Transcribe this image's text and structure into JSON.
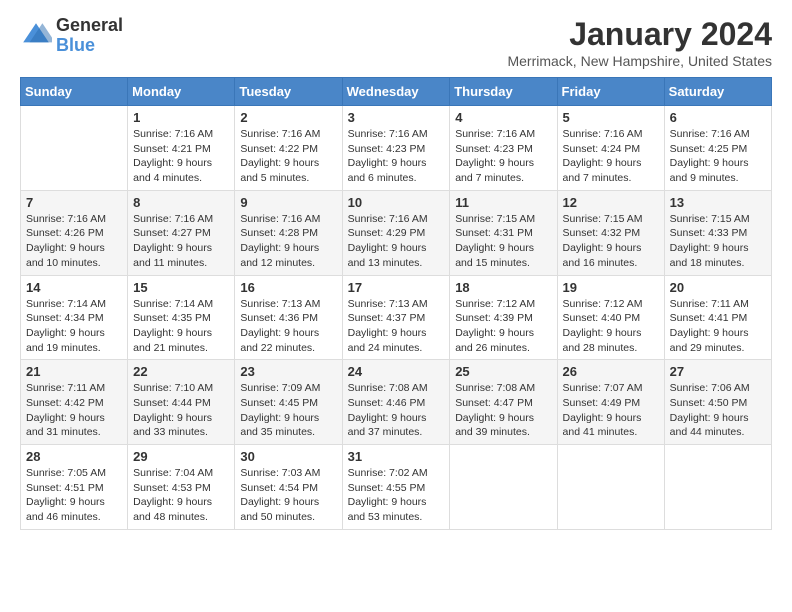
{
  "logo": {
    "line1": "General",
    "line2": "Blue"
  },
  "title": "January 2024",
  "location": "Merrimack, New Hampshire, United States",
  "header": {
    "days": [
      "Sunday",
      "Monday",
      "Tuesday",
      "Wednesday",
      "Thursday",
      "Friday",
      "Saturday"
    ]
  },
  "weeks": [
    [
      {
        "day": "",
        "sunrise": "",
        "sunset": "",
        "daylight": ""
      },
      {
        "day": "1",
        "sunrise": "Sunrise: 7:16 AM",
        "sunset": "Sunset: 4:21 PM",
        "daylight": "Daylight: 9 hours and 4 minutes."
      },
      {
        "day": "2",
        "sunrise": "Sunrise: 7:16 AM",
        "sunset": "Sunset: 4:22 PM",
        "daylight": "Daylight: 9 hours and 5 minutes."
      },
      {
        "day": "3",
        "sunrise": "Sunrise: 7:16 AM",
        "sunset": "Sunset: 4:23 PM",
        "daylight": "Daylight: 9 hours and 6 minutes."
      },
      {
        "day": "4",
        "sunrise": "Sunrise: 7:16 AM",
        "sunset": "Sunset: 4:23 PM",
        "daylight": "Daylight: 9 hours and 7 minutes."
      },
      {
        "day": "5",
        "sunrise": "Sunrise: 7:16 AM",
        "sunset": "Sunset: 4:24 PM",
        "daylight": "Daylight: 9 hours and 7 minutes."
      },
      {
        "day": "6",
        "sunrise": "Sunrise: 7:16 AM",
        "sunset": "Sunset: 4:25 PM",
        "daylight": "Daylight: 9 hours and 9 minutes."
      }
    ],
    [
      {
        "day": "7",
        "sunrise": "Sunrise: 7:16 AM",
        "sunset": "Sunset: 4:26 PM",
        "daylight": "Daylight: 9 hours and 10 minutes."
      },
      {
        "day": "8",
        "sunrise": "Sunrise: 7:16 AM",
        "sunset": "Sunset: 4:27 PM",
        "daylight": "Daylight: 9 hours and 11 minutes."
      },
      {
        "day": "9",
        "sunrise": "Sunrise: 7:16 AM",
        "sunset": "Sunset: 4:28 PM",
        "daylight": "Daylight: 9 hours and 12 minutes."
      },
      {
        "day": "10",
        "sunrise": "Sunrise: 7:16 AM",
        "sunset": "Sunset: 4:29 PM",
        "daylight": "Daylight: 9 hours and 13 minutes."
      },
      {
        "day": "11",
        "sunrise": "Sunrise: 7:15 AM",
        "sunset": "Sunset: 4:31 PM",
        "daylight": "Daylight: 9 hours and 15 minutes."
      },
      {
        "day": "12",
        "sunrise": "Sunrise: 7:15 AM",
        "sunset": "Sunset: 4:32 PM",
        "daylight": "Daylight: 9 hours and 16 minutes."
      },
      {
        "day": "13",
        "sunrise": "Sunrise: 7:15 AM",
        "sunset": "Sunset: 4:33 PM",
        "daylight": "Daylight: 9 hours and 18 minutes."
      }
    ],
    [
      {
        "day": "14",
        "sunrise": "Sunrise: 7:14 AM",
        "sunset": "Sunset: 4:34 PM",
        "daylight": "Daylight: 9 hours and 19 minutes."
      },
      {
        "day": "15",
        "sunrise": "Sunrise: 7:14 AM",
        "sunset": "Sunset: 4:35 PM",
        "daylight": "Daylight: 9 hours and 21 minutes."
      },
      {
        "day": "16",
        "sunrise": "Sunrise: 7:13 AM",
        "sunset": "Sunset: 4:36 PM",
        "daylight": "Daylight: 9 hours and 22 minutes."
      },
      {
        "day": "17",
        "sunrise": "Sunrise: 7:13 AM",
        "sunset": "Sunset: 4:37 PM",
        "daylight": "Daylight: 9 hours and 24 minutes."
      },
      {
        "day": "18",
        "sunrise": "Sunrise: 7:12 AM",
        "sunset": "Sunset: 4:39 PM",
        "daylight": "Daylight: 9 hours and 26 minutes."
      },
      {
        "day": "19",
        "sunrise": "Sunrise: 7:12 AM",
        "sunset": "Sunset: 4:40 PM",
        "daylight": "Daylight: 9 hours and 28 minutes."
      },
      {
        "day": "20",
        "sunrise": "Sunrise: 7:11 AM",
        "sunset": "Sunset: 4:41 PM",
        "daylight": "Daylight: 9 hours and 29 minutes."
      }
    ],
    [
      {
        "day": "21",
        "sunrise": "Sunrise: 7:11 AM",
        "sunset": "Sunset: 4:42 PM",
        "daylight": "Daylight: 9 hours and 31 minutes."
      },
      {
        "day": "22",
        "sunrise": "Sunrise: 7:10 AM",
        "sunset": "Sunset: 4:44 PM",
        "daylight": "Daylight: 9 hours and 33 minutes."
      },
      {
        "day": "23",
        "sunrise": "Sunrise: 7:09 AM",
        "sunset": "Sunset: 4:45 PM",
        "daylight": "Daylight: 9 hours and 35 minutes."
      },
      {
        "day": "24",
        "sunrise": "Sunrise: 7:08 AM",
        "sunset": "Sunset: 4:46 PM",
        "daylight": "Daylight: 9 hours and 37 minutes."
      },
      {
        "day": "25",
        "sunrise": "Sunrise: 7:08 AM",
        "sunset": "Sunset: 4:47 PM",
        "daylight": "Daylight: 9 hours and 39 minutes."
      },
      {
        "day": "26",
        "sunrise": "Sunrise: 7:07 AM",
        "sunset": "Sunset: 4:49 PM",
        "daylight": "Daylight: 9 hours and 41 minutes."
      },
      {
        "day": "27",
        "sunrise": "Sunrise: 7:06 AM",
        "sunset": "Sunset: 4:50 PM",
        "daylight": "Daylight: 9 hours and 44 minutes."
      }
    ],
    [
      {
        "day": "28",
        "sunrise": "Sunrise: 7:05 AM",
        "sunset": "Sunset: 4:51 PM",
        "daylight": "Daylight: 9 hours and 46 minutes."
      },
      {
        "day": "29",
        "sunrise": "Sunrise: 7:04 AM",
        "sunset": "Sunset: 4:53 PM",
        "daylight": "Daylight: 9 hours and 48 minutes."
      },
      {
        "day": "30",
        "sunrise": "Sunrise: 7:03 AM",
        "sunset": "Sunset: 4:54 PM",
        "daylight": "Daylight: 9 hours and 50 minutes."
      },
      {
        "day": "31",
        "sunrise": "Sunrise: 7:02 AM",
        "sunset": "Sunset: 4:55 PM",
        "daylight": "Daylight: 9 hours and 53 minutes."
      },
      {
        "day": "",
        "sunrise": "",
        "sunset": "",
        "daylight": ""
      },
      {
        "day": "",
        "sunrise": "",
        "sunset": "",
        "daylight": ""
      },
      {
        "day": "",
        "sunrise": "",
        "sunset": "",
        "daylight": ""
      }
    ]
  ]
}
